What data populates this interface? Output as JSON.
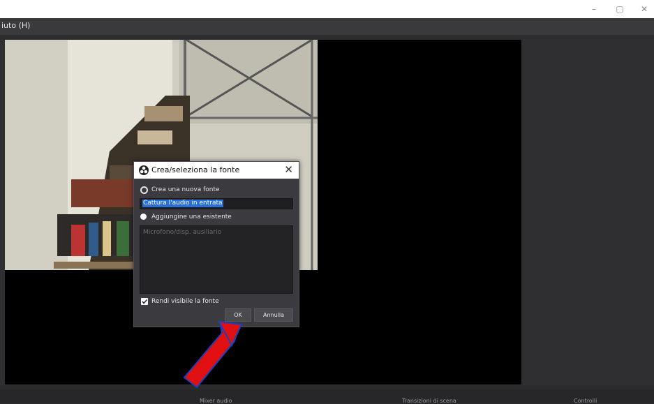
{
  "window": {
    "controls": {
      "minimize": "–",
      "restore": "▢",
      "close": "✕"
    }
  },
  "menubar": {
    "visible_item": "iuto (H)"
  },
  "dialog": {
    "title": "Crea/seleziona la fonte",
    "close_glyph": "✕",
    "option_new_label": "Crea una nuova fonte",
    "new_source_value": "Cattura l'audio in entrata",
    "option_existing_label": "Aggiungine una esistente",
    "existing_sources": [
      "Microfono/disp. ausiliario"
    ],
    "visible_checkbox_label": "Rendi visibile la fonte",
    "visible_checked": true,
    "ok_label": "OK",
    "cancel_label": "Annulla"
  },
  "docks": {
    "titles": [
      "Mixer audio",
      "Transizioni di scena",
      "Controlli"
    ]
  },
  "annotation": {
    "arrow_color": "#e01010",
    "arrow_outline": "#1a3fbf"
  },
  "colors": {
    "accent_selection": "#2a6fd6",
    "panel_bg": "#3b3b3f"
  }
}
